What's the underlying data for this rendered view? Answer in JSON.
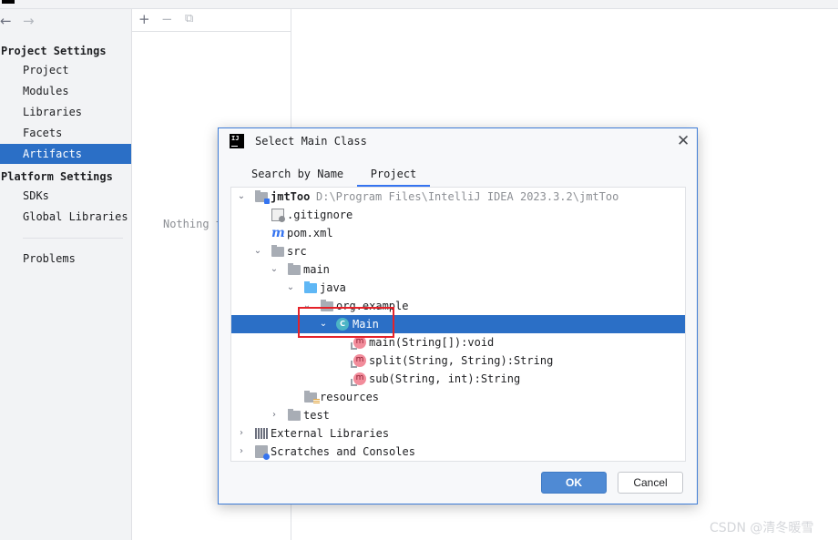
{
  "left_nav": {
    "project_settings_header": "Project Settings",
    "project_settings": [
      "Project",
      "Modules",
      "Libraries",
      "Facets",
      "Artifacts"
    ],
    "platform_settings_header": "Platform Settings",
    "platform_settings": [
      "SDKs",
      "Global Libraries"
    ],
    "problems": "Problems",
    "selected": "Artifacts"
  },
  "middle_panel": {
    "empty_text": "Nothing t"
  },
  "dialog": {
    "title": "Select Main Class",
    "tabs": [
      "Search by Name",
      "Project"
    ],
    "active_tab": "Project",
    "tree": [
      {
        "label": "jmtToo",
        "path": "D:\\Program Files\\IntelliJ IDEA 2023.3.2\\jmtToo",
        "icon": "module-folder-icon",
        "expanded": true
      },
      {
        "label": ".gitignore",
        "icon": "gitignore-file-icon"
      },
      {
        "label": "pom.xml",
        "icon": "maven-icon"
      },
      {
        "label": "src",
        "icon": "folder-icon",
        "expanded": true
      },
      {
        "label": "main",
        "icon": "folder-icon",
        "expanded": true
      },
      {
        "label": "java",
        "icon": "source-folder-icon",
        "expanded": true
      },
      {
        "label": "org.example",
        "icon": "package-icon",
        "expanded": true
      },
      {
        "label": "Main",
        "icon": "class-icon",
        "expanded": true,
        "selected": true
      },
      {
        "label": "main(String[]):void",
        "icon": "method-icon"
      },
      {
        "label": "split(String, String):String",
        "icon": "method-icon"
      },
      {
        "label": "sub(String, int):String",
        "icon": "method-icon"
      },
      {
        "label": "resources",
        "icon": "resources-folder-icon"
      },
      {
        "label": "test",
        "icon": "folder-icon",
        "expanded": false
      },
      {
        "label": "External Libraries",
        "icon": "libraries-icon",
        "expanded": false
      },
      {
        "label": "Scratches and Consoles",
        "icon": "scratches-icon",
        "expanded": false
      }
    ],
    "ok_label": "OK",
    "cancel_label": "Cancel"
  },
  "watermark": "CSDN @清冬暖雪",
  "colors": {
    "selection": "#2b6fc6",
    "ok_button": "#4f8ad4",
    "highlight_box": "#e5222a"
  }
}
